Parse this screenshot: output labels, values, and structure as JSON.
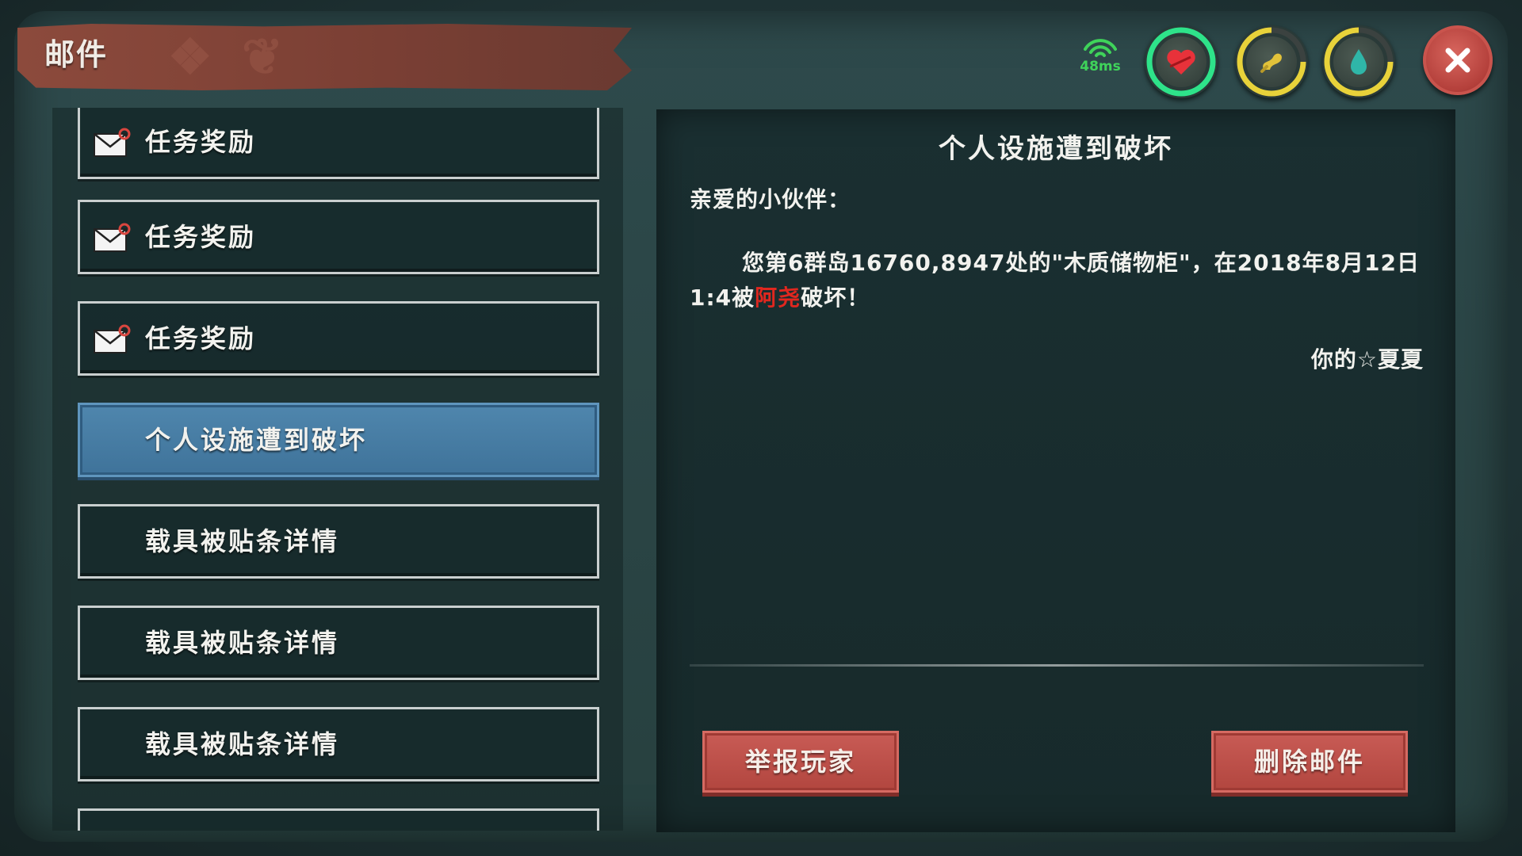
{
  "window": {
    "title": "邮件",
    "ping": "48ms"
  },
  "status_gauges": [
    {
      "name": "health",
      "ring_color": "#2ee38a",
      "icon": "heart-icon"
    },
    {
      "name": "hunger",
      "ring_color": "#e8d23a",
      "icon": "food-icon"
    },
    {
      "name": "thirst",
      "ring_color": "#e8d23a",
      "icon": "water-drop-icon"
    }
  ],
  "mail_list": [
    {
      "label": "任务奖励",
      "icon": "envelope-icon",
      "selected": false
    },
    {
      "label": "任务奖励",
      "icon": "envelope-icon",
      "selected": false
    },
    {
      "label": "任务奖励",
      "icon": "envelope-icon",
      "selected": false
    },
    {
      "label": "个人设施遭到破坏",
      "selected": true
    },
    {
      "label": "载具被贴条详情",
      "selected": false
    },
    {
      "label": "载具被贴条详情",
      "selected": false
    },
    {
      "label": "载具被贴条详情",
      "selected": false
    }
  ],
  "detail": {
    "title": "个人设施遭到破坏",
    "greeting": "亲爱的小伙伴：",
    "body_before": "您第6群岛16760,8947处的\"木质储物柜\"，在2018年8月12日 1:4被",
    "body_highlight": "阿尧",
    "body_after": "破坏！",
    "signature": "你的☆夏夏",
    "report_button": "举报玩家",
    "delete_button": "删除邮件"
  },
  "colors": {
    "highlight_name": "#e0271f",
    "selected_item": "#4a80a8",
    "button_red": "#be524b",
    "ping_green": "#3fd35a"
  }
}
